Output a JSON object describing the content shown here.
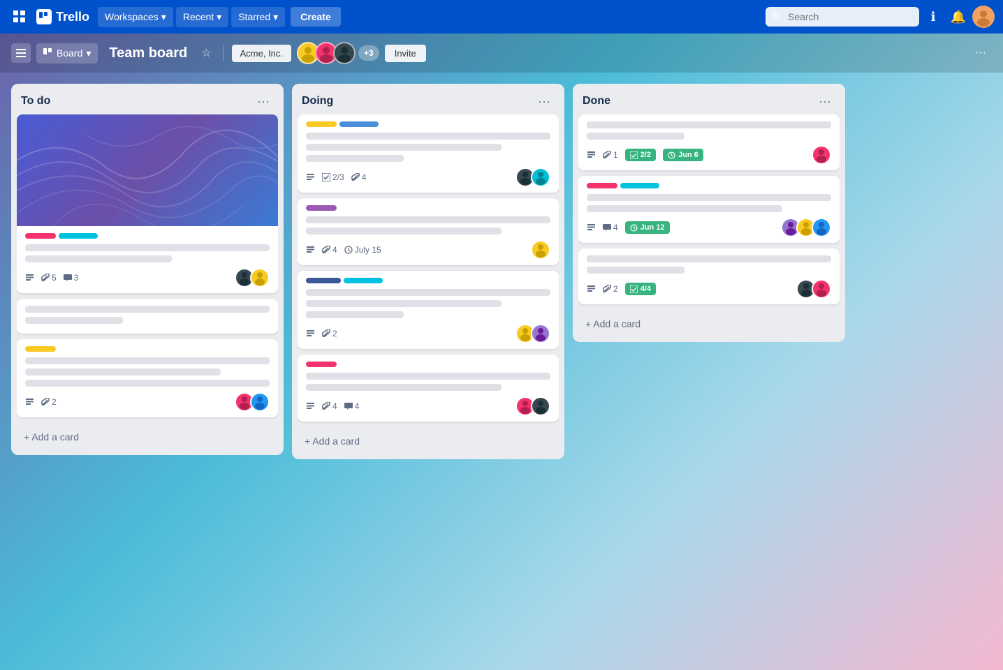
{
  "navbar": {
    "logo_text": "Trello",
    "workspaces_label": "Workspaces",
    "recent_label": "Recent",
    "starred_label": "Starred",
    "create_label": "Create",
    "search_placeholder": "Search",
    "chevron": "▾"
  },
  "board_header": {
    "view_label": "Board",
    "title": "Team board",
    "workspace_label": "Acme, Inc.",
    "more_members": "+3",
    "invite_label": "Invite",
    "more_label": "···"
  },
  "columns": [
    {
      "id": "todo",
      "title": "To do",
      "add_card_label": "+ Add a card",
      "cards": [
        {
          "id": "card-1",
          "has_image": true,
          "labels": [
            {
              "color": "#F4336D",
              "type": "label"
            },
            {
              "color": "#00C2E0",
              "type": "label"
            }
          ],
          "lines": [
            "full",
            "short"
          ],
          "meta": {
            "desc": true,
            "attachments": "5",
            "comments": "3"
          },
          "avatars": [
            "teal",
            "yellow"
          ]
        },
        {
          "id": "card-2",
          "has_image": false,
          "lines": [
            "full",
            "xshort"
          ],
          "labels": [],
          "meta": {},
          "avatars": []
        },
        {
          "id": "card-3",
          "has_image": false,
          "labels": [
            {
              "color": "#F9CA24",
              "type": "label"
            }
          ],
          "lines": [
            "full",
            "medium",
            "full"
          ],
          "meta": {
            "desc": true,
            "attachments": "2"
          },
          "avatars": [
            "pink",
            "blue"
          ]
        }
      ]
    },
    {
      "id": "doing",
      "title": "Doing",
      "add_card_label": "+ Add a card",
      "cards": [
        {
          "id": "card-4",
          "labels": [
            {
              "color": "#F9CA24",
              "type": "label"
            },
            {
              "color": "#4A90D9",
              "type": "label"
            }
          ],
          "lines": [
            "full",
            "medium",
            "xshort"
          ],
          "meta": {
            "desc": true,
            "checklist": "2/3",
            "attachments": "4"
          },
          "avatars": [
            "dark",
            "blue"
          ]
        },
        {
          "id": "card-5",
          "labels": [
            {
              "color": "#9B59B6",
              "type": "label"
            }
          ],
          "lines": [
            "full",
            "medium"
          ],
          "meta": {
            "desc": true,
            "attachments": "4",
            "due": "July 15"
          },
          "avatars": [
            "yellow"
          ]
        },
        {
          "id": "card-6",
          "labels": [
            {
              "color": "#3B5998",
              "type": "label"
            },
            {
              "color": "#00C2E0",
              "type": "label"
            }
          ],
          "lines": [
            "full",
            "medium",
            "xshort"
          ],
          "meta": {
            "desc": true,
            "attachments": "2"
          },
          "avatars": [
            "yellow",
            "purple"
          ]
        },
        {
          "id": "card-7",
          "labels": [
            {
              "color": "#F4336D",
              "type": "label"
            }
          ],
          "lines": [
            "full",
            "medium"
          ],
          "meta": {
            "desc": true,
            "attachments": "4",
            "comments": "4"
          },
          "avatars": [
            "pink",
            "dark"
          ]
        }
      ]
    },
    {
      "id": "done",
      "title": "Done",
      "add_card_label": "+ Add a card",
      "cards": [
        {
          "id": "card-8",
          "lines": [
            "full",
            "xshort"
          ],
          "labels": [],
          "meta": {
            "desc": true,
            "attachments": "1",
            "checklist_badge": "2/2",
            "due_badge": "Jun 6"
          },
          "avatars": [
            "pink-face"
          ]
        },
        {
          "id": "card-9",
          "labels": [
            {
              "color": "#F4336D",
              "type": "label"
            },
            {
              "color": "#00C2E0",
              "type": "label"
            }
          ],
          "lines": [
            "full",
            "medium"
          ],
          "meta": {
            "desc": true,
            "comments": "4",
            "due_badge": "Jun 12"
          },
          "avatars": [
            "lavender",
            "yellow",
            "blue"
          ]
        },
        {
          "id": "card-10",
          "lines": [
            "full",
            "xshort"
          ],
          "labels": [],
          "meta": {
            "desc": true,
            "attachments": "2",
            "checklist_badge": "4/4"
          },
          "avatars": [
            "dark",
            "pink"
          ]
        }
      ]
    }
  ]
}
